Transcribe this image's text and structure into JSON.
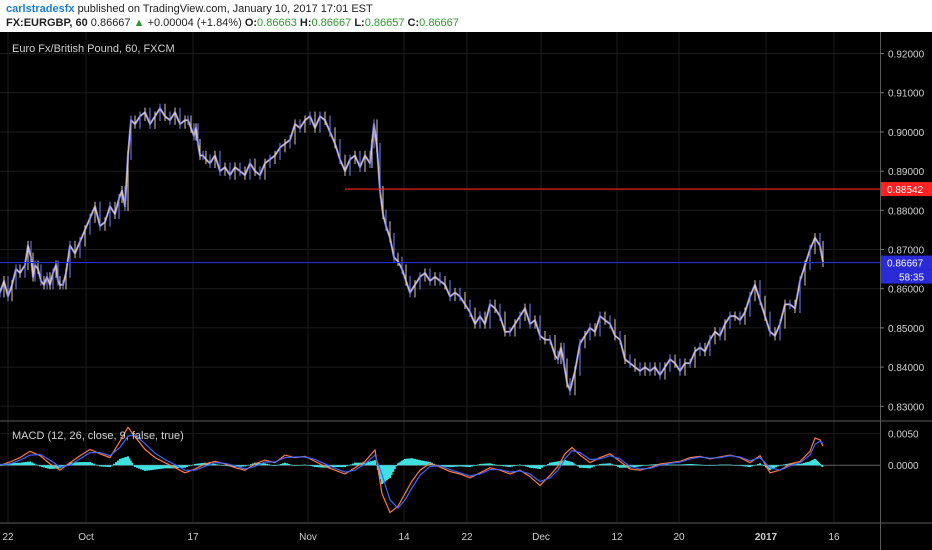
{
  "header": {
    "author": "carlstradesfx",
    "published_text": "published on TradingView.com, January 10, 2017 17:01 EST",
    "symbol_interval": "FX:EURGBP, 60",
    "last_price": "0.86667",
    "change_arrow": "▲",
    "change": "+0.00004 (+1.84%)",
    "open_label": "O:",
    "open": "0.86663",
    "high_label": "H:",
    "high": "0.86667",
    "low_label": "L:",
    "low": "0.86657",
    "close_label": "C:",
    "close": "0.86667"
  },
  "colors": {
    "background": "#000000",
    "grid": "#1c1c1c",
    "candle": "#e0c8a8",
    "candle_alt": "#7a82ff",
    "resistance": "#ff2222",
    "current_price_line": "#2a2ad6",
    "macd_line": "#ff7a3d",
    "signal_line": "#3f63ff",
    "histogram": "#3fe0e0"
  },
  "chart_data": [
    {
      "type": "line",
      "title": "Euro Fx/British Pound, 60, FXCM",
      "x_ticks": [
        "22",
        "Oct",
        "17",
        "Nov",
        "14",
        "22",
        "Dec",
        "12",
        "20",
        "2017",
        "16"
      ],
      "y_ticks": [
        "0.92000",
        "0.91000",
        "0.90000",
        "0.89000",
        "0.88000",
        "0.87000",
        "0.86000",
        "0.85000",
        "0.84000",
        "0.83000"
      ],
      "ylim": [
        0.8265,
        0.9255
      ],
      "series": [
        {
          "x": [
            0,
            4,
            8,
            12,
            16,
            20,
            25,
            28,
            31,
            33,
            35,
            38,
            41,
            44,
            47,
            50,
            53,
            56,
            58,
            60,
            63,
            66,
            70,
            75,
            80,
            85,
            90,
            95,
            100,
            105,
            110,
            115,
            119,
            122,
            125,
            128,
            131,
            135,
            140,
            145,
            150,
            155,
            160,
            165,
            170,
            175,
            180,
            185,
            188,
            191,
            194,
            196,
            198,
            200,
            203,
            206,
            210,
            215,
            220,
            225,
            230,
            235,
            240,
            245,
            250,
            255,
            260,
            265,
            270,
            275,
            280,
            285,
            290,
            295,
            300,
            305,
            310,
            315,
            320,
            325,
            330,
            335,
            340,
            345,
            350,
            355,
            360,
            365,
            370,
            372,
            374,
            377,
            380,
            383,
            386,
            390,
            394,
            398,
            402,
            406,
            410,
            415,
            420,
            425,
            430,
            435,
            440,
            445,
            450,
            455,
            460,
            465,
            470,
            475,
            480,
            485,
            490,
            495,
            500,
            505,
            510,
            515,
            520,
            525,
            530,
            535,
            540,
            545,
            550,
            555,
            558,
            561,
            564,
            567,
            570,
            575,
            580,
            585,
            590,
            595,
            600,
            605,
            610,
            615,
            620,
            625,
            630,
            635,
            640,
            645,
            650,
            655,
            660,
            665,
            670,
            675,
            680,
            685,
            690,
            695,
            700,
            705,
            710,
            715,
            720,
            725,
            730,
            735,
            740,
            745,
            750,
            755,
            760,
            765,
            770,
            775,
            780,
            785,
            790,
            795,
            800,
            805,
            810,
            815,
            820,
            823
          ],
          "values": [
            0.859,
            0.862,
            0.858,
            0.861,
            0.865,
            0.864,
            0.866,
            0.871,
            0.868,
            0.863,
            0.866,
            0.865,
            0.862,
            0.861,
            0.863,
            0.861,
            0.864,
            0.866,
            0.862,
            0.861,
            0.861,
            0.864,
            0.871,
            0.869,
            0.872,
            0.875,
            0.878,
            0.881,
            0.876,
            0.877,
            0.881,
            0.879,
            0.883,
            0.885,
            0.881,
            0.894,
            0.903,
            0.902,
            0.904,
            0.905,
            0.902,
            0.904,
            0.906,
            0.904,
            0.903,
            0.905,
            0.902,
            0.903,
            0.903,
            0.901,
            0.899,
            0.901,
            0.897,
            0.894,
            0.894,
            0.893,
            0.892,
            0.894,
            0.89,
            0.891,
            0.889,
            0.891,
            0.89,
            0.889,
            0.892,
            0.89,
            0.889,
            0.892,
            0.893,
            0.894,
            0.896,
            0.897,
            0.898,
            0.902,
            0.901,
            0.903,
            0.904,
            0.901,
            0.904,
            0.903,
            0.9,
            0.897,
            0.893,
            0.89,
            0.893,
            0.894,
            0.891,
            0.894,
            0.892,
            0.897,
            0.902,
            0.896,
            0.885,
            0.879,
            0.876,
            0.873,
            0.868,
            0.867,
            0.865,
            0.862,
            0.859,
            0.861,
            0.863,
            0.864,
            0.862,
            0.863,
            0.862,
            0.861,
            0.858,
            0.859,
            0.858,
            0.856,
            0.854,
            0.851,
            0.853,
            0.851,
            0.856,
            0.855,
            0.853,
            0.849,
            0.849,
            0.851,
            0.853,
            0.855,
            0.851,
            0.852,
            0.848,
            0.847,
            0.847,
            0.843,
            0.842,
            0.845,
            0.841,
            0.836,
            0.834,
            0.839,
            0.846,
            0.848,
            0.85,
            0.849,
            0.853,
            0.852,
            0.851,
            0.848,
            0.847,
            0.842,
            0.841,
            0.84,
            0.839,
            0.84,
            0.839,
            0.84,
            0.838,
            0.84,
            0.842,
            0.841,
            0.839,
            0.841,
            0.841,
            0.844,
            0.845,
            0.844,
            0.847,
            0.849,
            0.848,
            0.851,
            0.853,
            0.853,
            0.852,
            0.854,
            0.858,
            0.861,
            0.857,
            0.853,
            0.849,
            0.848,
            0.851,
            0.856,
            0.856,
            0.855,
            0.862,
            0.866,
            0.87,
            0.873,
            0.871,
            0.8667
          ]
        }
      ],
      "horizontal_lines": [
        {
          "label": "0.88542",
          "value": 0.88542,
          "color": "#ff2222",
          "from_x": 345
        },
        {
          "label": "0.86667",
          "value": 0.86667,
          "color": "#2a2ad6",
          "from_x": 0
        }
      ],
      "countdown_label": "58:35",
      "xlim": [
        0,
        880
      ],
      "x_tick_positions": [
        8,
        86,
        193,
        308,
        404,
        467,
        541,
        617,
        679,
        766,
        834
      ]
    },
    {
      "type": "line",
      "title": "MACD (12, 26, close, 9, false, true)",
      "y_ticks": [
        "0.0050",
        "0.0000"
      ],
      "ylim": [
        -0.009,
        0.007
      ],
      "zero_label": "0.0000",
      "series": [
        {
          "x": [
            0,
            10,
            20,
            30,
            40,
            50,
            60,
            70,
            80,
            90,
            100,
            110,
            120,
            128,
            135,
            145,
            155,
            165,
            175,
            185,
            195,
            205,
            215,
            225,
            235,
            245,
            255,
            265,
            275,
            285,
            295,
            305,
            315,
            325,
            335,
            345,
            355,
            365,
            375,
            382,
            390,
            398,
            405,
            412,
            420,
            430,
            440,
            450,
            460,
            470,
            480,
            490,
            500,
            510,
            520,
            530,
            540,
            550,
            558,
            565,
            572,
            580,
            590,
            600,
            610,
            620,
            630,
            640,
            650,
            660,
            670,
            680,
            690,
            700,
            710,
            720,
            730,
            740,
            750,
            760,
            770,
            780,
            790,
            800,
            810,
            815,
            820,
            823
          ],
          "values": [
            0.0,
            0.0005,
            0.0012,
            0.0022,
            0.0015,
            0.0002,
            -0.0008,
            0.0004,
            0.0015,
            0.0025,
            0.0018,
            0.0012,
            0.0038,
            0.006,
            0.0045,
            0.0025,
            0.0012,
            0.0004,
            -0.0004,
            -0.0012,
            -0.0006,
            0.0002,
            0.0006,
            0.0002,
            -0.0004,
            -0.0008,
            0.0002,
            0.0008,
            0.0004,
            0.0016,
            0.0012,
            0.0014,
            0.0006,
            -0.0002,
            -0.0008,
            -0.0014,
            -0.0004,
            0.0006,
            0.0024,
            -0.0045,
            -0.0075,
            -0.0065,
            -0.0045,
            -0.0025,
            -0.0008,
            0.0003,
            -0.0003,
            -0.001,
            -0.0014,
            -0.002,
            -0.0012,
            -0.0004,
            -0.0008,
            -0.0014,
            -0.0008,
            -0.0018,
            -0.0032,
            -0.0016,
            -0.0002,
            0.0018,
            0.0028,
            0.0016,
            0.0004,
            0.0012,
            0.0018,
            0.0006,
            -0.0006,
            -0.0008,
            -0.0004,
            0.0002,
            0.0004,
            0.0006,
            0.0012,
            0.0014,
            0.001,
            0.0013,
            0.0016,
            0.0012,
            0.0004,
            0.0015,
            -0.0012,
            -0.0008,
            0.0002,
            0.0006,
            0.0022,
            0.0043,
            0.004,
            0.003
          ]
        },
        {
          "x": [
            0,
            10,
            20,
            30,
            40,
            50,
            60,
            70,
            80,
            90,
            100,
            110,
            120,
            128,
            135,
            145,
            155,
            165,
            175,
            185,
            195,
            205,
            215,
            225,
            235,
            245,
            255,
            265,
            275,
            285,
            295,
            305,
            315,
            325,
            335,
            345,
            355,
            365,
            375,
            382,
            390,
            398,
            405,
            412,
            420,
            430,
            440,
            450,
            460,
            470,
            480,
            490,
            500,
            510,
            520,
            530,
            540,
            550,
            558,
            565,
            572,
            580,
            590,
            600,
            610,
            620,
            630,
            640,
            650,
            660,
            670,
            680,
            690,
            700,
            710,
            720,
            730,
            740,
            750,
            760,
            770,
            780,
            790,
            800,
            810,
            815,
            820,
            823
          ],
          "values": [
            0.0001,
            0.0002,
            0.0008,
            0.0016,
            0.0017,
            0.0008,
            -0.0003,
            0.0,
            0.001,
            0.002,
            0.002,
            0.0015,
            0.0028,
            0.0046,
            0.0048,
            0.0034,
            0.0019,
            0.0009,
            0.0001,
            -0.0008,
            -0.0008,
            -0.0002,
            0.0004,
            0.0003,
            -0.0001,
            -0.0006,
            -0.0002,
            0.0005,
            0.0005,
            0.0012,
            0.0013,
            0.0013,
            0.0009,
            0.0002,
            -0.0005,
            -0.0011,
            -0.0008,
            0.0002,
            0.0016,
            -0.0015,
            -0.0055,
            -0.0068,
            -0.0055,
            -0.0036,
            -0.0016,
            -0.0002,
            -0.0001,
            -0.0007,
            -0.0012,
            -0.0017,
            -0.0014,
            -0.0007,
            -0.0007,
            -0.0011,
            -0.0009,
            -0.0014,
            -0.0026,
            -0.002,
            -0.0008,
            0.001,
            0.0023,
            0.002,
            0.0009,
            0.001,
            0.0015,
            0.001,
            -0.0002,
            -0.0006,
            -0.0005,
            0.0,
            0.0003,
            0.0005,
            0.001,
            0.0013,
            0.0011,
            0.0012,
            0.0015,
            0.0013,
            0.0007,
            0.0012,
            -0.0004,
            -0.0008,
            -0.0001,
            0.0004,
            0.0016,
            0.0033,
            0.0038,
            0.0034
          ]
        }
      ]
    }
  ]
}
